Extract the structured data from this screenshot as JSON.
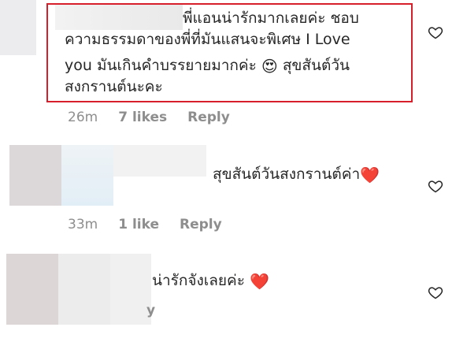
{
  "comments": [
    {
      "text_lines": [
        "พี่แอนน่ารักมากเลยค่ะ ชอบ",
        "ความธรรมดาของพี่ที่มันแสนจะพิเศษ I Love",
        "you มันเกินคำบรรยายมากค่ะ",
        "สงกรานต์นะคะ"
      ],
      "line3_suffix": "สุขสันต์วัน",
      "emoji": "😍",
      "time": "26m",
      "likes": "7 likes",
      "reply": "Reply",
      "highlighted": true
    },
    {
      "text": "สุขสันต์วันสงกรานต์ค่า",
      "emoji": "❤️",
      "time": "33m",
      "likes": "1 like",
      "reply": "Reply"
    },
    {
      "text": "น่ารักจังเลยค่ะ",
      "emoji": "❤️",
      "partial_meta": "y"
    }
  ],
  "colors": {
    "highlight_border": "#d61f2b",
    "meta_text": "#8e8e8e",
    "heart_emoji": "#e0312d"
  },
  "icons": [
    "heart-outline-icon"
  ]
}
